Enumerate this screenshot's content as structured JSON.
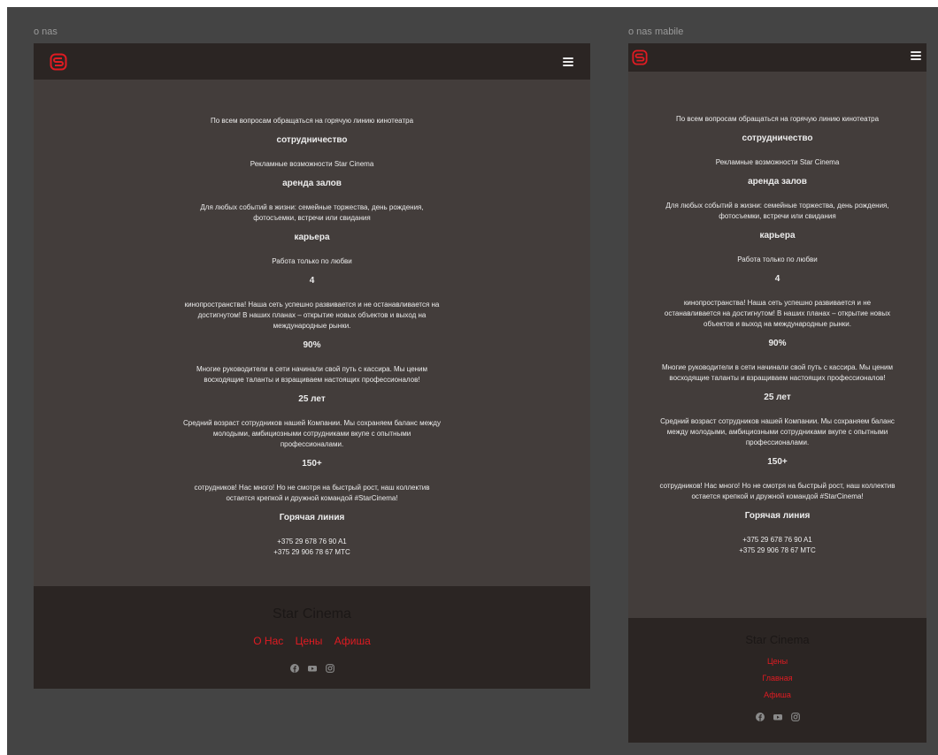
{
  "desktop": {
    "label": "o nas",
    "paragraphs": [
      {
        "kind": "p",
        "text": "По всем вопросам обращаться на горячую линию кинотеатра"
      },
      {
        "kind": "h",
        "text": "сотрудничество"
      },
      {
        "kind": "p",
        "text": "Рекламные возможности Star Cinema"
      },
      {
        "kind": "h",
        "text": "аренда залов"
      },
      {
        "kind": "p",
        "text": "Для любых событий в жизни: семейные торжества, день рождения,\nфотосъемки, встречи или свидания"
      },
      {
        "kind": "h",
        "text": "карьера"
      },
      {
        "kind": "p",
        "text": "Работа только по любви"
      },
      {
        "kind": "h",
        "text": "4"
      },
      {
        "kind": "p",
        "text": "кинопространства! Наша сеть успешно развивается и не останавливается на\nдостигнутом! В наших планах – открытие новых объектов и выход на\nмеждународные рынки."
      },
      {
        "kind": "h",
        "text": "90%"
      },
      {
        "kind": "p",
        "text": "Многие руководители в сети начинали свой путь с кассира. Мы ценим\nвосходящие таланты и взращиваем настоящих профессионалов!"
      },
      {
        "kind": "h",
        "text": "25 лет"
      },
      {
        "kind": "p",
        "text": "Средний возраст сотрудников нашей Компании. Мы сохраняем баланс между\nмолодыми, амбициозными сотрудниками вкупе с опытными\nпрофессионалами."
      },
      {
        "kind": "h",
        "text": "150+"
      },
      {
        "kind": "p",
        "text": "сотрудников! Нас много! Но не смотря на быстрый рост, наш коллектив\nостается крепкой и дружной командой #StarCinema!"
      },
      {
        "kind": "h",
        "text": "Горячая линия"
      },
      {
        "kind": "p",
        "text": "+375 29 678 76 90 A1\n+375 29 906 78 67 MTC"
      }
    ],
    "footer": {
      "brand": "Star Cinema",
      "links": [
        "О Нас",
        "Цены",
        "Афиша"
      ]
    }
  },
  "mobile": {
    "label": "o nas mabile",
    "paragraphs": [
      {
        "kind": "p",
        "text": "По всем вопросам обращаться на горячую линию кинотеатра"
      },
      {
        "kind": "h",
        "text": "сотрудничество"
      },
      {
        "kind": "p",
        "text": "Рекламные возможности Star Cinema"
      },
      {
        "kind": "h",
        "text": "аренда залов"
      },
      {
        "kind": "p",
        "text": "Для любых событий в жизни: семейные торжества, день рождения,\nфотосъемки, встречи или свидания"
      },
      {
        "kind": "h",
        "text": "карьера"
      },
      {
        "kind": "p",
        "text": "Работа только по любви"
      },
      {
        "kind": "h",
        "text": "4"
      },
      {
        "kind": "p",
        "text": "кинопространства! Наша сеть успешно развивается и не\nостанавливается на достигнутом! В наших планах – открытие новых\nобъектов и выход на международные рынки."
      },
      {
        "kind": "h",
        "text": "90%"
      },
      {
        "kind": "p",
        "text": "Многие руководители в сети начинали свой путь с кассира. Мы ценим\nвосходящие таланты и взращиваем настоящих профессионалов!"
      },
      {
        "kind": "h",
        "text": "25 лет"
      },
      {
        "kind": "p",
        "text": "Средний возраст сотрудников нашей Компании. Мы сохраняем баланс\nмежду молодыми, амбициозными сотрудниками вкупе с опытными\nпрофессионалами."
      },
      {
        "kind": "h",
        "text": "150+"
      },
      {
        "kind": "p",
        "text": "сотрудников! Нас много! Но не смотря на быстрый рост, наш коллектив\nостается крепкой и дружной командой #StarCinema!"
      },
      {
        "kind": "h",
        "text": "Горячая линия"
      },
      {
        "kind": "p",
        "text": "+375 29 678 76 90 A1\n+375 29 906 78 67 MTC"
      }
    ],
    "footer": {
      "brand": "Star Cinema",
      "links": [
        "Цены",
        "Главная",
        "Афиша"
      ]
    }
  },
  "icons": [
    "logo-icon",
    "menu-icon",
    "facebook-icon",
    "youtube-icon",
    "instagram-icon"
  ],
  "colors": {
    "accent": "#e01b22",
    "bar": "#2b2523",
    "body": "#433d3b",
    "canvas": "#444444"
  }
}
